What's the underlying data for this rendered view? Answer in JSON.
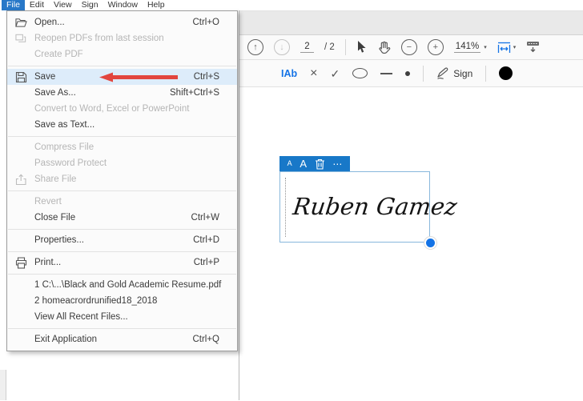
{
  "menubar": {
    "items": [
      {
        "label": "File"
      },
      {
        "label": "Edit"
      },
      {
        "label": "View"
      },
      {
        "label": "Sign"
      },
      {
        "label": "Window"
      },
      {
        "label": "Help"
      }
    ]
  },
  "file_menu": {
    "open": {
      "label": "Open...",
      "shortcut": "Ctrl+O"
    },
    "reopen": {
      "label": "Reopen PDFs from last session"
    },
    "create_pdf": {
      "label": "Create PDF"
    },
    "save": {
      "label": "Save",
      "shortcut": "Ctrl+S"
    },
    "save_as": {
      "label": "Save As...",
      "shortcut": "Shift+Ctrl+S"
    },
    "convert": {
      "label": "Convert to Word, Excel or PowerPoint"
    },
    "save_as_text": {
      "label": "Save as Text..."
    },
    "compress": {
      "label": "Compress File"
    },
    "password_protect": {
      "label": "Password Protect"
    },
    "share_file": {
      "label": "Share File"
    },
    "revert": {
      "label": "Revert"
    },
    "close_file": {
      "label": "Close File",
      "shortcut": "Ctrl+W"
    },
    "properties": {
      "label": "Properties...",
      "shortcut": "Ctrl+D"
    },
    "print": {
      "label": "Print...",
      "shortcut": "Ctrl+P"
    },
    "recent_1": {
      "label": "1 C:\\...\\Black and Gold Academic Resume.pdf"
    },
    "recent_2": {
      "label": "2 homeacrordrunified18_2018"
    },
    "view_all_recent": {
      "label": "View All Recent Files..."
    },
    "exit": {
      "label": "Exit Application",
      "shortcut": "Ctrl+Q"
    }
  },
  "toolbar": {
    "page_current": "2",
    "page_total": "/ 2",
    "zoom_level": "141%",
    "prev_page_glyph": "↑",
    "next_page_glyph": "↓",
    "zoom_out_glyph": "−",
    "zoom_in_glyph": "+",
    "zoom_caret_glyph": "▾",
    "fit_caret_glyph": "▾"
  },
  "fill_sign_toolbar": {
    "add_text_label": "IAb",
    "cross_glyph": "×",
    "check_glyph": "✓",
    "sign_label": "Sign"
  },
  "signature_widget": {
    "name": "Ruben Gamez",
    "font_decrease_glyph": "A",
    "font_increase_glyph": "A",
    "more_options_glyph": "⋯"
  },
  "colors": {
    "menubar_active_bg": "#2878c8",
    "save_row_highlight": "#ddecfa",
    "annotation_arrow_red": "#e2453e",
    "accent_blue": "#1473e6",
    "signature_toolbar_blue": "#1878c8"
  }
}
